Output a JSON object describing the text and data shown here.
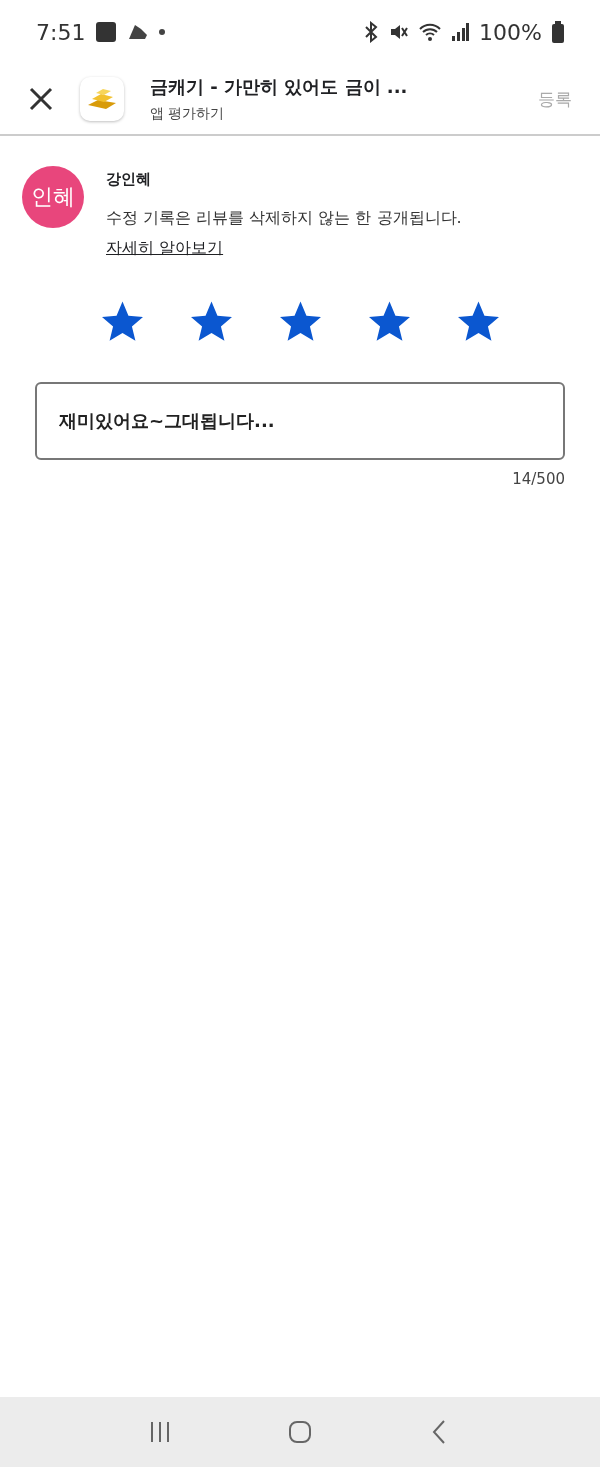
{
  "status_bar": {
    "time": "7:51",
    "battery": "100%"
  },
  "header": {
    "title": "금캐기 - 가만히 있어도 금이 ...",
    "subtitle": "앱 평가하기",
    "submit": "등록",
    "submit_disabled": true
  },
  "author": {
    "initials": "인혜",
    "name": "강인혜",
    "color": "#e8467c"
  },
  "notice": {
    "text": "수정 기록은 리뷰를 삭제하지 않는 한 공개됩니다.",
    "link": "자세히 알아보기"
  },
  "rating": {
    "stars": 5
  },
  "review": {
    "value": "재미있어요~그대됩니다...",
    "counter": "14/500"
  }
}
